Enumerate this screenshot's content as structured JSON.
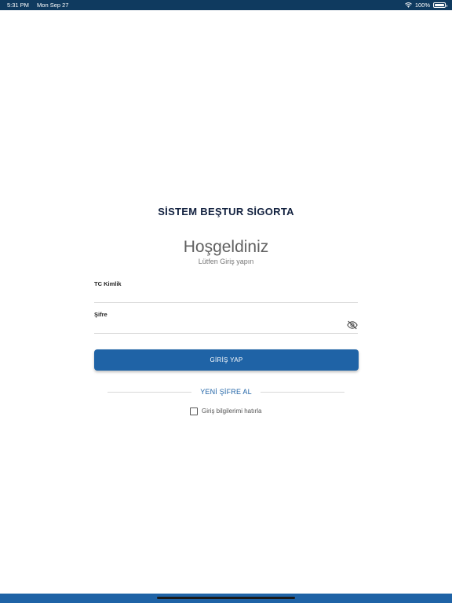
{
  "status_bar": {
    "time": "5:31 PM",
    "date": "Mon Sep 27",
    "battery": "100%",
    "wifi_icon": "wifi-icon",
    "battery_icon": "battery-icon"
  },
  "logo": {
    "text": "SİSTEM BEŞTUR SİGORTA"
  },
  "welcome": {
    "title": "Hoşgeldiniz",
    "subtitle": "Lütfen Giriş yapın"
  },
  "form": {
    "tc_label": "TC Kimlik",
    "tc_value": "",
    "password_label": "Şifre",
    "password_value": "",
    "password_toggle_icon": "eye-off-icon"
  },
  "login_button": {
    "label": "GİRİŞ YAP"
  },
  "new_password_link": {
    "label": "YENİ ŞİFRE AL"
  },
  "remember_me": {
    "label": "Giriş bilgilerimi hatırla",
    "checked": false
  },
  "colors": {
    "status_bar": "#0f3a5f",
    "primary": "#1f63a6",
    "logo": "#12213f"
  }
}
